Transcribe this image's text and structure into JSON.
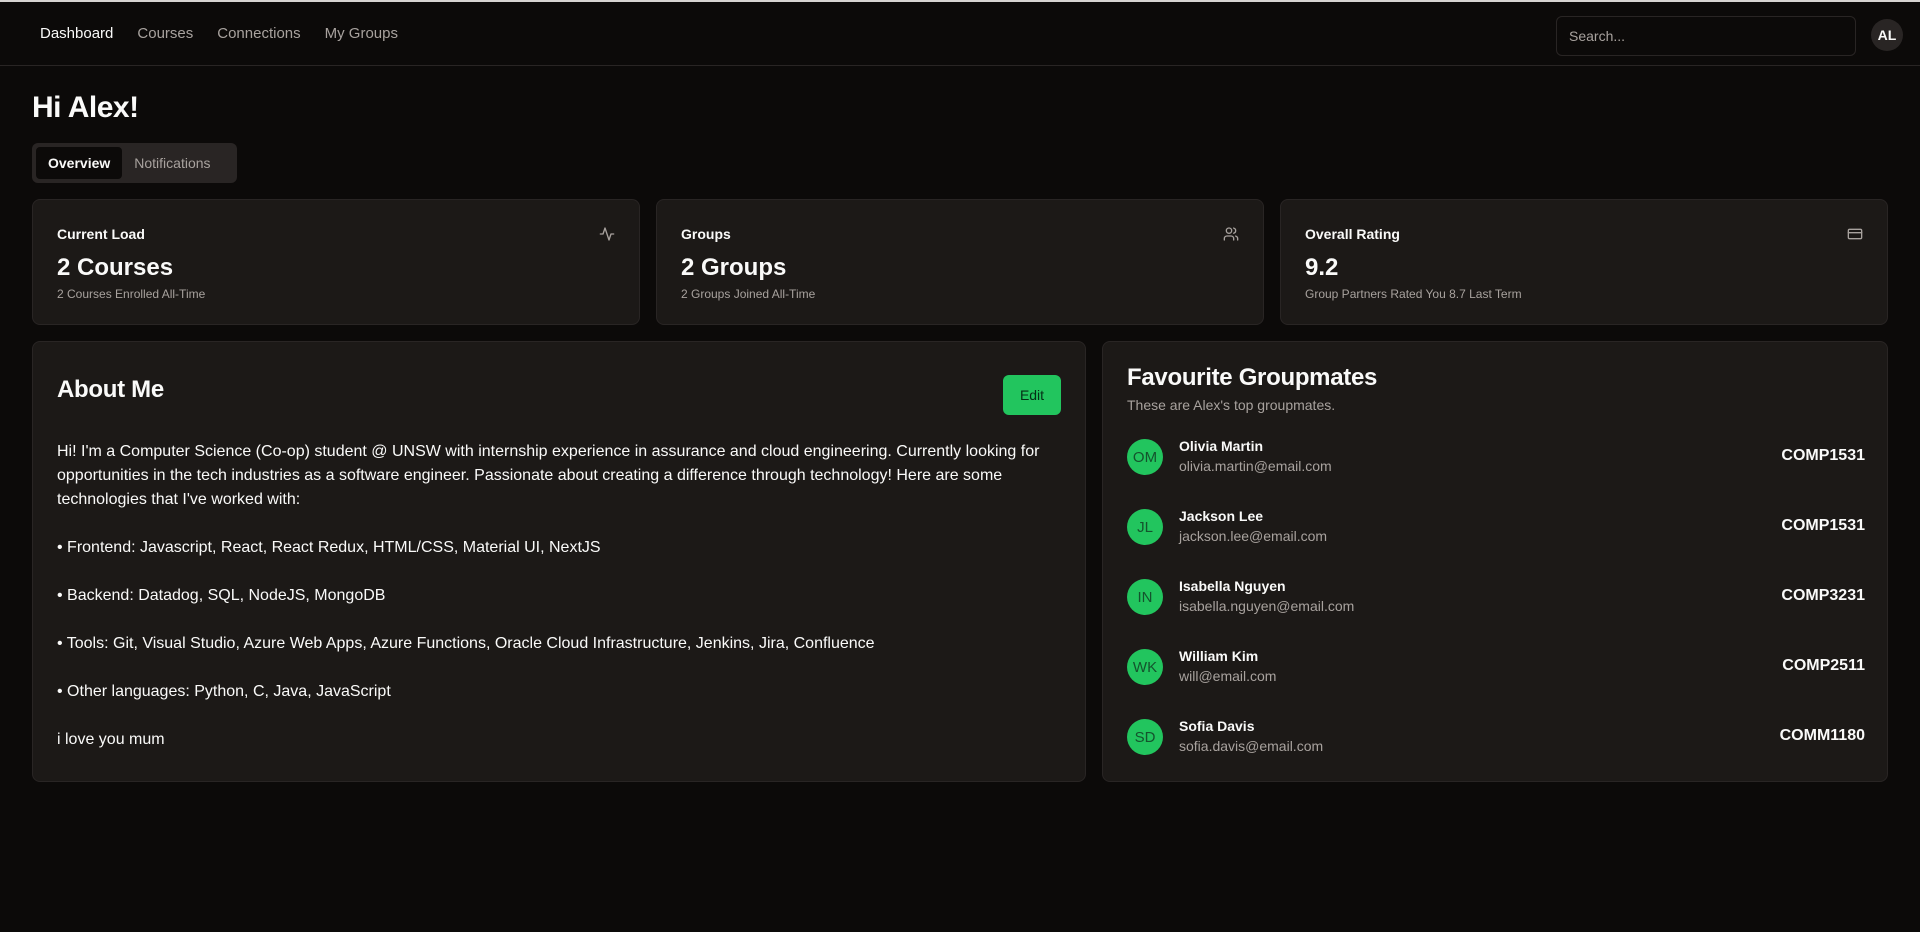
{
  "nav": {
    "items": [
      {
        "label": "Dashboard"
      },
      {
        "label": "Courses"
      },
      {
        "label": "Connections"
      },
      {
        "label": "My Groups"
      }
    ]
  },
  "search": {
    "placeholder": "Search..."
  },
  "user": {
    "initials": "AL"
  },
  "greeting": "Hi Alex!",
  "tabs": [
    {
      "label": "Overview"
    },
    {
      "label": "Notifications"
    }
  ],
  "stats": [
    {
      "title": "Current Load",
      "value": "2 Courses",
      "sub": "2 Courses Enrolled All-Time",
      "icon": "activity-icon"
    },
    {
      "title": "Groups",
      "value": "2 Groups",
      "sub": "2 Groups Joined All-Time",
      "icon": "users-icon"
    },
    {
      "title": "Overall Rating",
      "value": "9.2",
      "sub": "Group Partners Rated You 8.7 Last Term",
      "icon": "credit-card-icon"
    }
  ],
  "about": {
    "title": "About Me",
    "edit_label": "Edit",
    "paragraphs": [
      "Hi! I'm a Computer Science (Co-op) student @ UNSW with internship experience in assurance and cloud engineering. Currently looking for opportunities in the tech industries as a software engineer. Passionate about creating a difference through technology! Here are some technologies that I've worked with:",
      "• Frontend: Javascript, React, React Redux, HTML/CSS, Material UI, NextJS",
      "• Backend: Datadog, SQL, NodeJS, MongoDB",
      "• Tools: Git, Visual Studio, Azure Web Apps, Azure Functions, Oracle Cloud Infrastructure, Jenkins, Jira, Confluence",
      "• Other languages: Python, C, Java, JavaScript",
      "i love you mum"
    ]
  },
  "favourites": {
    "title": "Favourite Groupmates",
    "subtitle": "These are Alex's top groupmates.",
    "mates": [
      {
        "initials": "OM",
        "name": "Olivia Martin",
        "email": "olivia.martin@email.com",
        "course": "COMP1531"
      },
      {
        "initials": "JL",
        "name": "Jackson Lee",
        "email": "jackson.lee@email.com",
        "course": "COMP1531"
      },
      {
        "initials": "IN",
        "name": "Isabella Nguyen",
        "email": "isabella.nguyen@email.com",
        "course": "COMP3231"
      },
      {
        "initials": "WK",
        "name": "William Kim",
        "email": "will@email.com",
        "course": "COMP2511"
      },
      {
        "initials": "SD",
        "name": "Sofia Davis",
        "email": "sofia.davis@email.com",
        "course": "COMM1180"
      }
    ]
  },
  "colors": {
    "accent": "#22c55e",
    "background": "#0c0a09",
    "card": "#1c1917",
    "border": "#292524",
    "muted_text": "#a8a29e"
  }
}
